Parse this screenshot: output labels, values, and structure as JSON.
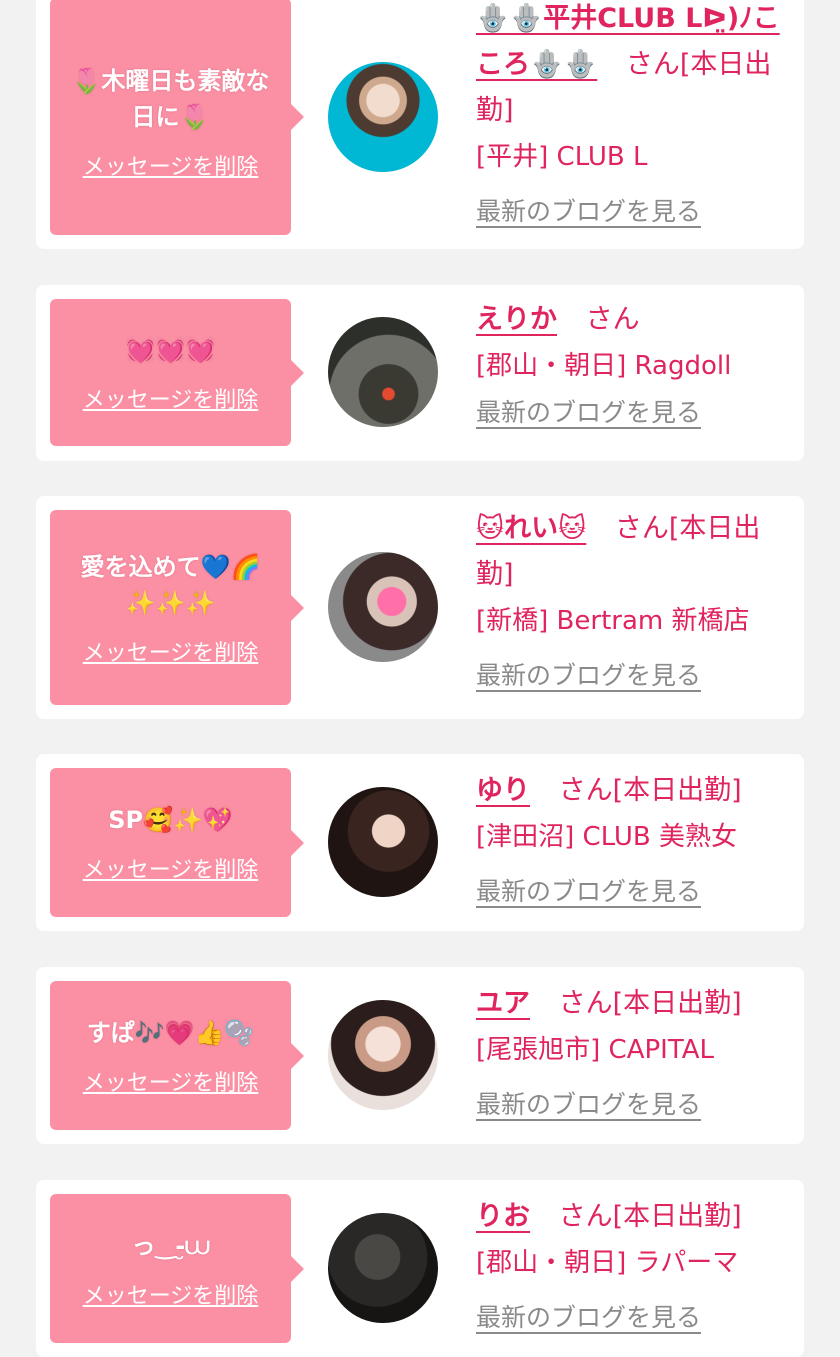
{
  "ui": {
    "delete_label": "メッセージを削除",
    "blog_label": "最新のブログを見る",
    "san": "さん",
    "on_duty": "[本日出勤]"
  },
  "colors": {
    "bubble": "#fb90a4",
    "accent": "#e0245e",
    "link_gray": "#8a8a8a",
    "background": "#f2f2f2"
  },
  "items": [
    {
      "message": "🌷木曜日も素敵な日に🌷",
      "name": "🪬🪬平井CLUB Lᐅ̤)ﾉこころ🪬🪬",
      "status": "[本日出勤]",
      "shop": "[平井] CLUB L"
    },
    {
      "message": "💓💓💓",
      "name": "えりか",
      "status": "",
      "shop": "[郡山・朝日] Ragdoll"
    },
    {
      "message": "愛を込めて💙🌈✨✨✨",
      "name": "🐱れい🐱",
      "status": "[本日出勤]",
      "shop": "[新橋] Bertram 新橋店"
    },
    {
      "message": "SP🥰✨💖",
      "name": "ゆり",
      "status": "[本日出勤]",
      "shop": "[津田沼] CLUB 美熟女"
    },
    {
      "message": "すぱ🎶💗👍🫧",
      "name": "ユア",
      "status": "[本日出勤]",
      "shop": "[尾張旭市] CAPITAL"
    },
    {
      "message": "っ‿-̮⩊",
      "name": "りお",
      "status": "[本日出勤]",
      "shop": "[郡山・朝日] ラパーマ"
    }
  ]
}
